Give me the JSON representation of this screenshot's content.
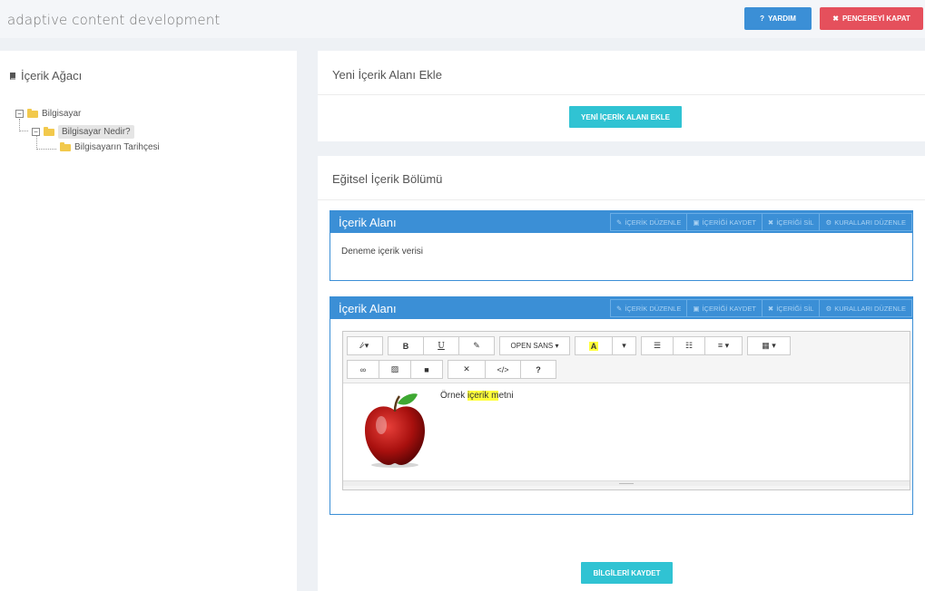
{
  "header": {
    "title": "adaptive content development",
    "help_label": "YARDIM",
    "close_label": "PENCEREYİ KAPAT"
  },
  "tree": {
    "heading": "İçerik Ağacı",
    "nodes": [
      {
        "label": "Bilgisayar",
        "toggle": "−"
      },
      {
        "label": "Bilgisayar Nedir?",
        "toggle": "−"
      },
      {
        "label": "Bilgisayarın Tarihçesi"
      }
    ]
  },
  "add_section": {
    "title": "Yeni İçerik Alanı Ekle",
    "button_label": "YENİ İÇERİK ALANI EKLE"
  },
  "edu_section": {
    "title": "Eğitsel İçerik Bölümü"
  },
  "content_areas": [
    {
      "title": "İçerik Alanı",
      "text": "Deneme içerik verisi"
    },
    {
      "title": "İçerik Alanı"
    }
  ],
  "content_actions": {
    "edit": "İÇERİK DÜZENLE",
    "save": "İÇERİĞİ KAYDET",
    "delete": "İÇERİĞİ SİL",
    "rules": "KURALLARI DÜZENLE"
  },
  "editor": {
    "font_select": "OPEN SANS",
    "text_before": "Örnek ",
    "text_highlight": "içerik m",
    "text_after": "etni"
  },
  "save_button_label": "BİLGİLERİ KAYDET",
  "colors": {
    "primary": "#3b8fd6",
    "danger": "#e5505c",
    "teal": "#30c3d3",
    "highlight": "#ffff3a"
  }
}
